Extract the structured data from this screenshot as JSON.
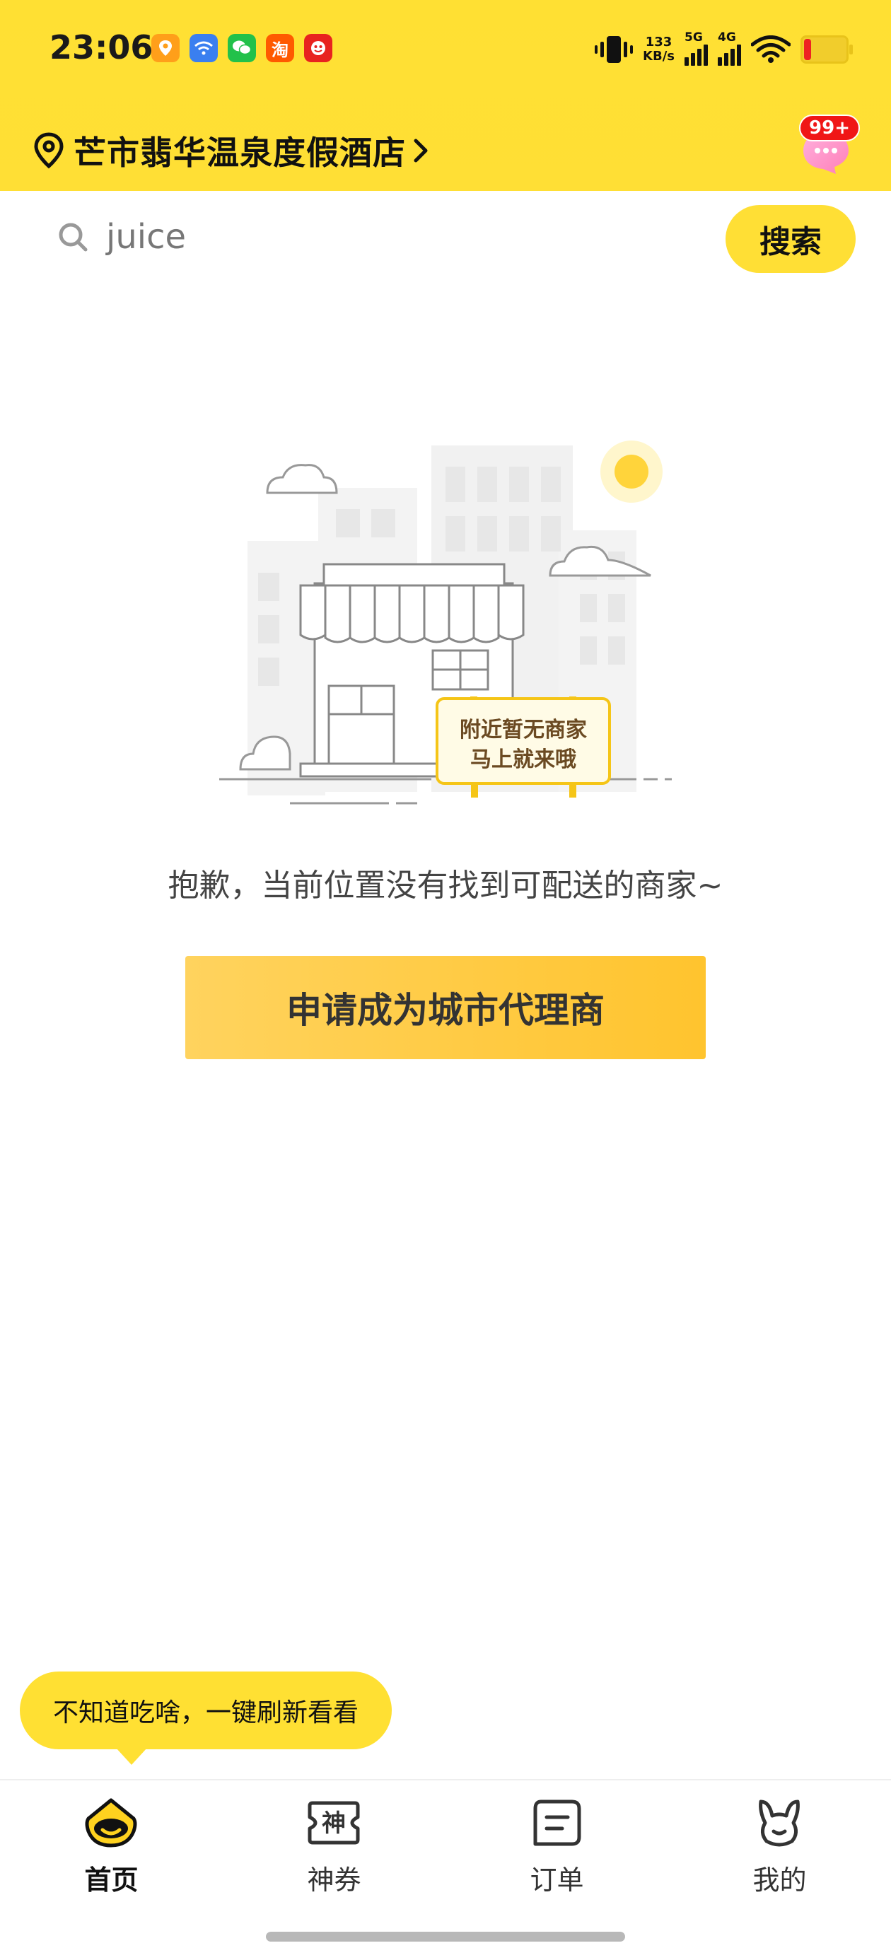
{
  "status_bar": {
    "time": "23:06",
    "net_speed_value": "133",
    "net_speed_unit": "KB/s",
    "signal_1": "5G",
    "signal_2": "4G",
    "app_icons": [
      "map-pin-icon",
      "wifi-app-icon",
      "wechat-icon",
      "taobao-icon",
      "mascot-app-icon"
    ],
    "taobao_char": "淘"
  },
  "header": {
    "location": "芒市翡华温泉度假酒店",
    "message_badge": "99+"
  },
  "search": {
    "value": "juice",
    "button_label": "搜索"
  },
  "empty_state": {
    "sign_line_1": "附近暂无商家",
    "sign_line_2": "马上就来哦",
    "message": "抱歉，当前位置没有找到可配送的商家~",
    "cta_label": "申请成为城市代理商"
  },
  "tooltip": {
    "text": "不知道吃啥，一键刷新看看"
  },
  "tabbar": {
    "tabs": [
      {
        "label": "首页",
        "icon": "home-icon",
        "active": true
      },
      {
        "label": "神券",
        "icon": "coupon-icon",
        "icon_char": "神",
        "active": false
      },
      {
        "label": "订单",
        "icon": "order-icon",
        "active": false
      },
      {
        "label": "我的",
        "icon": "profile-icon",
        "active": false
      }
    ]
  },
  "colors": {
    "brand_yellow": "#ffe033",
    "cta_gradient_start": "#ffd35e",
    "cta_gradient_end": "#ffc42e",
    "badge_red": "#f01616"
  }
}
